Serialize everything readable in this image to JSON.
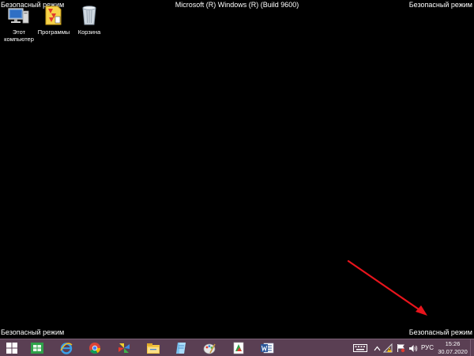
{
  "screen": {
    "safe_mode_label": "Безопасный режим",
    "build_title": "Microsoft (R) Windows (R) (Build 9600)",
    "background_color": "#000000"
  },
  "desktop_icons": [
    {
      "name": "computer-icon",
      "label": "Этот\nкомпьютер"
    },
    {
      "name": "programs-folder-icon",
      "label": "Программы"
    },
    {
      "name": "recycle-bin-icon",
      "label": "Корзина"
    }
  ],
  "annotation": {
    "type": "red-arrow",
    "color": "#e8141c",
    "points_to": "safe_mode_label_bottom_right"
  },
  "taskbar": {
    "color": "#5a3f53",
    "pinned_apps": [
      "windows-start-icon",
      "spreadsheet-app-icon",
      "internet-explorer-icon",
      "chrome-icon",
      "pinwheel-app-icon",
      "file-explorer-icon",
      "notepad-app-icon",
      "paint-app-icon",
      "card-app-icon",
      "word-icon"
    ],
    "tray": {
      "icons": [
        "keyboard-icon",
        "up-arrow-icon",
        "network-warning-icon",
        "tray-flag-icon",
        "volume-icon"
      ],
      "language": "РУС",
      "time": "15:26",
      "date": "30.07.2020"
    }
  }
}
